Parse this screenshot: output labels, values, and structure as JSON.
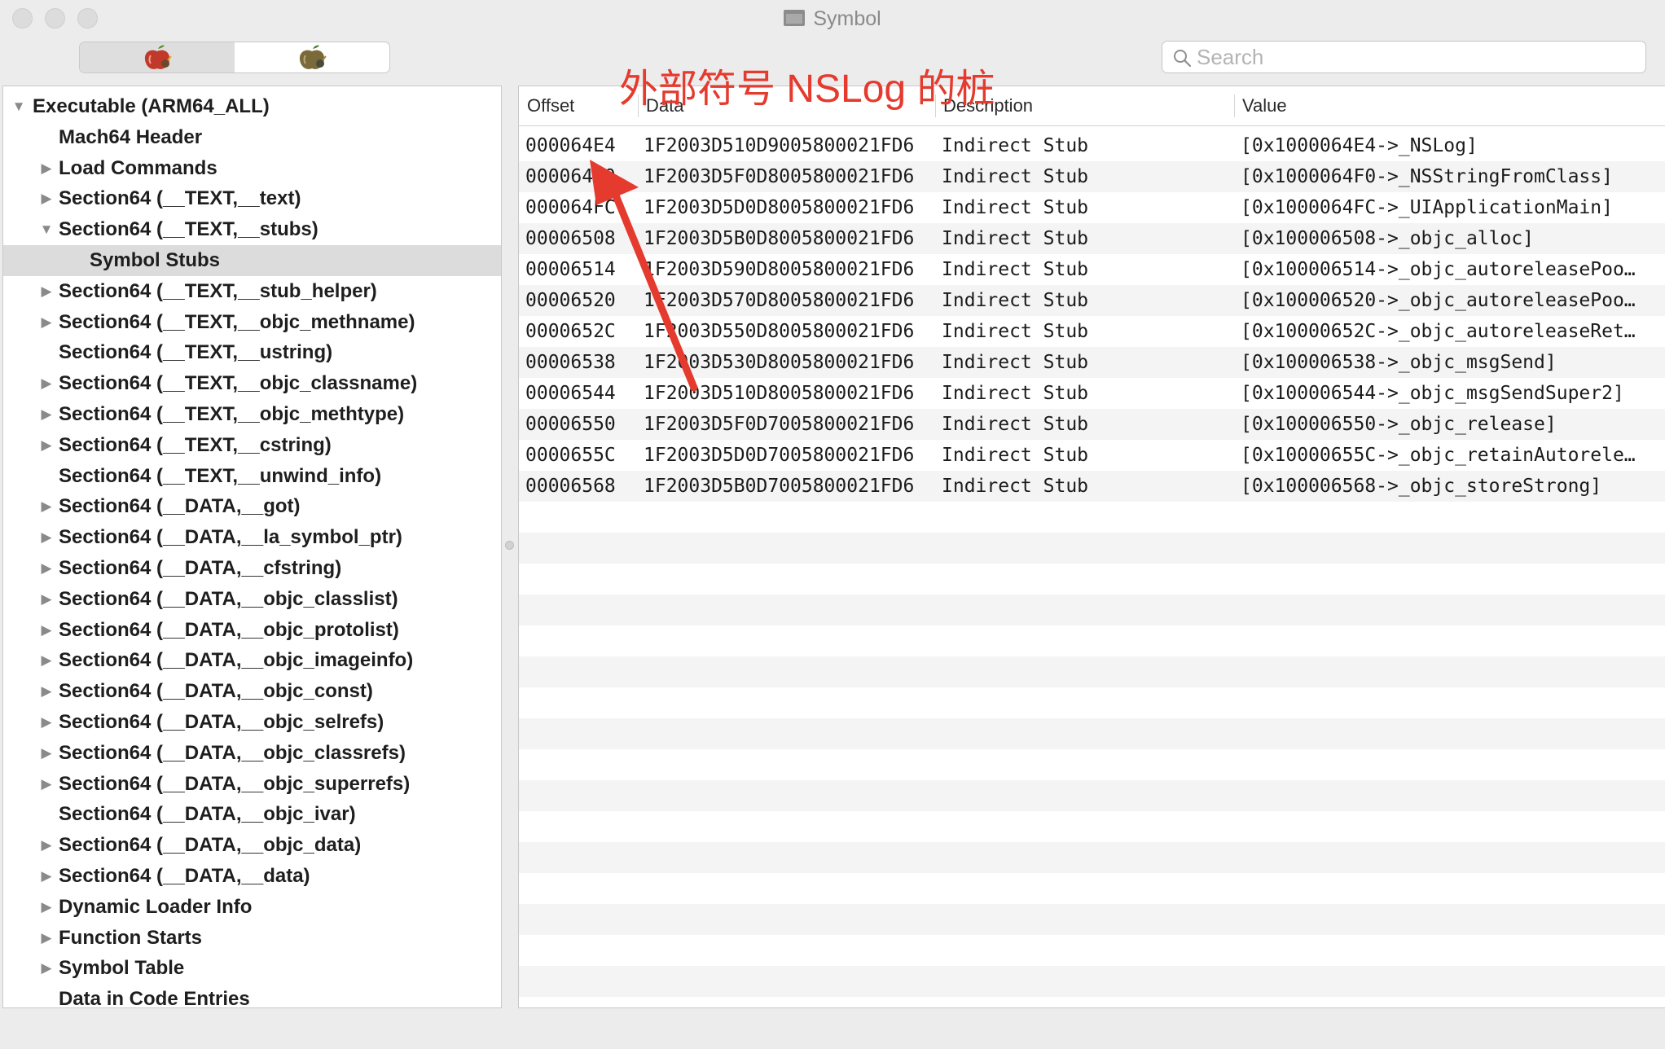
{
  "window": {
    "title": "Symbol",
    "accent_color": "#e53a2e"
  },
  "toolbar": {
    "segments": [
      {
        "icon": "apple-bomb-icon",
        "active": true
      },
      {
        "icon": "apple-bomb-icon",
        "active": false
      }
    ],
    "search": {
      "placeholder": "Search",
      "value": ""
    }
  },
  "sidebar": {
    "items": [
      {
        "label": "Executable  (ARM64_ALL)",
        "level": 0,
        "disclosure": "expanded",
        "selected": false
      },
      {
        "label": "Mach64 Header",
        "level": 1,
        "disclosure": "none",
        "selected": false
      },
      {
        "label": "Load Commands",
        "level": 1,
        "disclosure": "collapsed",
        "selected": false
      },
      {
        "label": "Section64 (__TEXT,__text)",
        "level": 1,
        "disclosure": "collapsed",
        "selected": false
      },
      {
        "label": "Section64 (__TEXT,__stubs)",
        "level": 1,
        "disclosure": "expanded",
        "selected": false
      },
      {
        "label": "Symbol Stubs",
        "level": 2,
        "disclosure": "none",
        "selected": true
      },
      {
        "label": "Section64 (__TEXT,__stub_helper)",
        "level": 1,
        "disclosure": "collapsed",
        "selected": false
      },
      {
        "label": "Section64 (__TEXT,__objc_methname)",
        "level": 1,
        "disclosure": "collapsed",
        "selected": false
      },
      {
        "label": "Section64 (__TEXT,__ustring)",
        "level": 1,
        "disclosure": "none",
        "selected": false
      },
      {
        "label": "Section64 (__TEXT,__objc_classname)",
        "level": 1,
        "disclosure": "collapsed",
        "selected": false
      },
      {
        "label": "Section64 (__TEXT,__objc_methtype)",
        "level": 1,
        "disclosure": "collapsed",
        "selected": false
      },
      {
        "label": "Section64 (__TEXT,__cstring)",
        "level": 1,
        "disclosure": "collapsed",
        "selected": false
      },
      {
        "label": "Section64 (__TEXT,__unwind_info)",
        "level": 1,
        "disclosure": "none",
        "selected": false
      },
      {
        "label": "Section64 (__DATA,__got)",
        "level": 1,
        "disclosure": "collapsed",
        "selected": false
      },
      {
        "label": "Section64 (__DATA,__la_symbol_ptr)",
        "level": 1,
        "disclosure": "collapsed",
        "selected": false
      },
      {
        "label": "Section64 (__DATA,__cfstring)",
        "level": 1,
        "disclosure": "collapsed",
        "selected": false
      },
      {
        "label": "Section64 (__DATA,__objc_classlist)",
        "level": 1,
        "disclosure": "collapsed",
        "selected": false
      },
      {
        "label": "Section64 (__DATA,__objc_protolist)",
        "level": 1,
        "disclosure": "collapsed",
        "selected": false
      },
      {
        "label": "Section64 (__DATA,__objc_imageinfo)",
        "level": 1,
        "disclosure": "collapsed",
        "selected": false
      },
      {
        "label": "Section64 (__DATA,__objc_const)",
        "level": 1,
        "disclosure": "collapsed",
        "selected": false
      },
      {
        "label": "Section64 (__DATA,__objc_selrefs)",
        "level": 1,
        "disclosure": "collapsed",
        "selected": false
      },
      {
        "label": "Section64 (__DATA,__objc_classrefs)",
        "level": 1,
        "disclosure": "collapsed",
        "selected": false
      },
      {
        "label": "Section64 (__DATA,__objc_superrefs)",
        "level": 1,
        "disclosure": "collapsed",
        "selected": false
      },
      {
        "label": "Section64 (__DATA,__objc_ivar)",
        "level": 1,
        "disclosure": "none",
        "selected": false
      },
      {
        "label": "Section64 (__DATA,__objc_data)",
        "level": 1,
        "disclosure": "collapsed",
        "selected": false
      },
      {
        "label": "Section64 (__DATA,__data)",
        "level": 1,
        "disclosure": "collapsed",
        "selected": false
      },
      {
        "label": "Dynamic Loader Info",
        "level": 1,
        "disclosure": "collapsed",
        "selected": false
      },
      {
        "label": "Function Starts",
        "level": 1,
        "disclosure": "collapsed",
        "selected": false
      },
      {
        "label": "Symbol Table",
        "level": 1,
        "disclosure": "collapsed",
        "selected": false
      },
      {
        "label": "Data in Code Entries",
        "level": 1,
        "disclosure": "none",
        "selected": false
      }
    ]
  },
  "table": {
    "columns": [
      {
        "key": "offset",
        "label": "Offset"
      },
      {
        "key": "data",
        "label": "Data"
      },
      {
        "key": "description",
        "label": "Description"
      },
      {
        "key": "value",
        "label": "Value"
      }
    ],
    "rows": [
      {
        "offset": "000064E4",
        "data": "1F2003D510D9005800021FD6",
        "description": "Indirect Stub",
        "value": "[0x1000064E4->_NSLog]"
      },
      {
        "offset": "000064F0",
        "data": "1F2003D5F0D8005800021FD6",
        "description": "Indirect Stub",
        "value": "[0x1000064F0->_NSStringFromClass]"
      },
      {
        "offset": "000064FC",
        "data": "1F2003D5D0D8005800021FD6",
        "description": "Indirect Stub",
        "value": "[0x1000064FC->_UIApplicationMain]"
      },
      {
        "offset": "00006508",
        "data": "1F2003D5B0D8005800021FD6",
        "description": "Indirect Stub",
        "value": "[0x100006508->_objc_alloc]"
      },
      {
        "offset": "00006514",
        "data": "1F2003D590D8005800021FD6",
        "description": "Indirect Stub",
        "value": "[0x100006514->_objc_autoreleasePoo…"
      },
      {
        "offset": "00006520",
        "data": "1F2003D570D8005800021FD6",
        "description": "Indirect Stub",
        "value": "[0x100006520->_objc_autoreleasePoo…"
      },
      {
        "offset": "0000652C",
        "data": "1F2003D550D8005800021FD6",
        "description": "Indirect Stub",
        "value": "[0x10000652C->_objc_autoreleaseRet…"
      },
      {
        "offset": "00006538",
        "data": "1F2003D530D8005800021FD6",
        "description": "Indirect Stub",
        "value": "[0x100006538->_objc_msgSend]"
      },
      {
        "offset": "00006544",
        "data": "1F2003D510D8005800021FD6",
        "description": "Indirect Stub",
        "value": "[0x100006544->_objc_msgSendSuper2]"
      },
      {
        "offset": "00006550",
        "data": "1F2003D5F0D7005800021FD6",
        "description": "Indirect Stub",
        "value": "[0x100006550->_objc_release]"
      },
      {
        "offset": "0000655C",
        "data": "1F2003D5D0D7005800021FD6",
        "description": "Indirect Stub",
        "value": "[0x10000655C->_objc_retainAutorele…"
      },
      {
        "offset": "00006568",
        "data": "1F2003D5B0D7005800021FD6",
        "description": "Indirect Stub",
        "value": "[0x100006568->_objc_storeStrong]"
      }
    ]
  },
  "annotation": {
    "text": "外部符号 NSLog 的桩"
  }
}
